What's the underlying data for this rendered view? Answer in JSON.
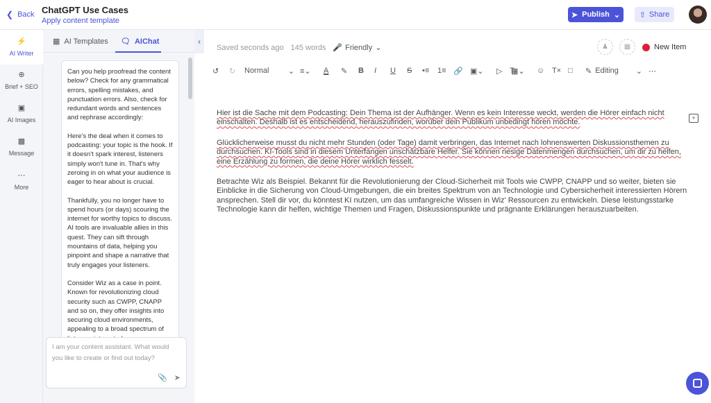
{
  "header": {
    "back_label": "Back",
    "title": "ChatGPT Use Cases",
    "subtitle": "Apply content template",
    "publish_label": "Publish",
    "share_label": "Share"
  },
  "rail": {
    "items": [
      {
        "label": "AI Writer",
        "icon": "lightning-icon"
      },
      {
        "label": "Brief + SEO",
        "icon": "target-icon"
      },
      {
        "label": "AI Images",
        "icon": "image-icon"
      },
      {
        "label": "Message",
        "icon": "message-icon"
      },
      {
        "label": "More",
        "icon": "more-dots-icon"
      }
    ]
  },
  "panel": {
    "tabs": [
      {
        "label": "AI Templates",
        "icon": "grid-icon"
      },
      {
        "label": "AIChat",
        "icon": "chat-bubbles-icon"
      }
    ],
    "messages": [
      "Can you help proofread the content below? Check for any grammatical errors, spelling mistakes, and punctuation errors. Also, check for redundant words and sentences and rephrase accordingly:",
      "Here's the deal when it comes to podcasting: your topic is the hook. If it doesn't spark interest, listeners simply won't tune in. That's why zeroing in on what your audience is eager to hear about is crucial.",
      "Thankfully, you no longer have to spend hours (or days) scouring the internet for worthy topics to discuss. AI tools are invaluable allies in this quest. They can sift through mountains of data, helping you pinpoint and shape a narrative that truly engages your listeners.",
      "Consider Wiz as a case in point. Known for revolutionizing cloud security such as CWPP, CNAPP and so on, they offer insights into securing cloud environments, appealing to a broad spectrum of listeners interested"
    ],
    "input_placeholder": "I am your content assistant. What would you like to create or find out today?"
  },
  "editor": {
    "saved_status": "Saved seconds ago",
    "word_count": "145 words",
    "tone": "Friendly",
    "new_item_label": "New Item",
    "style_select": "Normal",
    "mode_select": "Editing",
    "paragraphs": [
      "Hier ist die Sache mit dem Podcasting: Dein Thema ist der Aufhänger. Wenn es kein Interesse weckt, werden die Hörer einfach nicht einschalten. Deshalb ist es entscheidend, herauszufinden, worüber dein Publikum unbedingt hören möchte.",
      "Glücklicherweise musst du nicht mehr Stunden (oder Tage) damit verbringen, das Internet nach lohnenswerten Diskussionsthemen zu durchsuchen. KI-Tools sind in diesem Unterfangen unschätzbare Helfer. Sie können riesige Datenmengen durchsuchen, um dir zu helfen, eine Erzählung zu formen, die deine Hörer wirklich fesselt.",
      "Betrachte Wiz als Beispiel. Bekannt für die Revolutionierung der Cloud-Sicherheit mit Tools wie CWPP, CNAPP und so weiter, bieten sie Einblicke in die Sicherung von Cloud-Umgebungen, die ein breites Spektrum von an Technologie und Cybersicherheit interessierten Hörern ansprechen. Stell dir vor, du könntest KI nutzen, um das umfangreiche Wissen in Wiz' Ressourcen zu entwickeln. Diese leistungsstarke Technologie kann dir helfen, wichtige Themen und Fragen, Diskussionspunkte und prägnante Erklärungen herauszuarbeiten."
    ]
  },
  "colors": {
    "accent": "#4b53d9",
    "new_item_dot": "#dc1f3b",
    "rail_active_icon": "#f0a020"
  }
}
